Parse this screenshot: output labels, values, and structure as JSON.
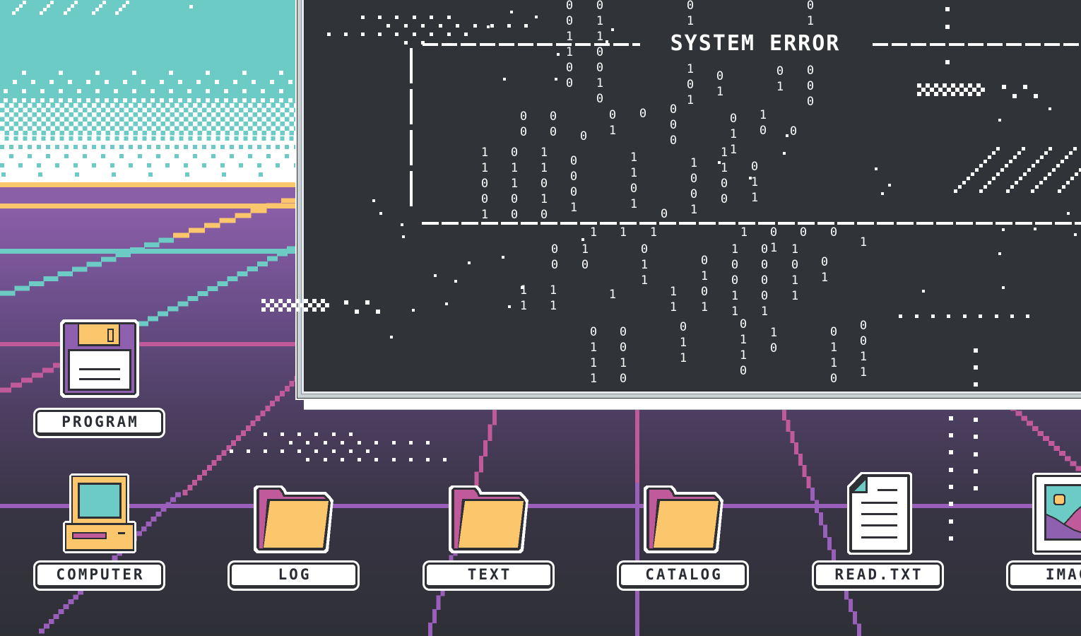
{
  "window": {
    "title": "SYSTEM ERROR"
  },
  "desktop_icons": [
    {
      "label": "PROGRAM",
      "icon": "floppy-disk-icon"
    },
    {
      "label": "COMPUTER",
      "icon": "computer-icon"
    },
    {
      "label": "LOG",
      "icon": "folder-icon"
    },
    {
      "label": "TEXT",
      "icon": "folder-icon"
    },
    {
      "label": "CATALOG",
      "icon": "folder-icon"
    },
    {
      "label": "READ.TXT",
      "icon": "document-icon"
    },
    {
      "label": "IMAGE",
      "icon": "image-icon"
    }
  ],
  "binary_columns": [
    {
      "digits": "001100"
    },
    {
      "digits": "0110010"
    },
    {
      "digits": "01"
    },
    {
      "digits": "101"
    },
    {
      "digits": "01"
    },
    {
      "digits": "000"
    },
    {
      "digits": "01"
    },
    {
      "digits": "01"
    },
    {
      "digits": "00"
    },
    {
      "digits": "00"
    },
    {
      "digits": "0"
    },
    {
      "digits": "01"
    },
    {
      "digits": "0"
    },
    {
      "digits": "000"
    },
    {
      "digits": "011"
    },
    {
      "digits": "10"
    },
    {
      "digits": "0"
    },
    {
      "digits": "11001"
    },
    {
      "digits": "01100"
    },
    {
      "digits": "11010"
    },
    {
      "digits": "0001"
    },
    {
      "digits": "1101"
    },
    {
      "digits": "0"
    },
    {
      "digits": "1001"
    },
    {
      "digits": "1100"
    },
    {
      "digits": "011"
    },
    {
      "digits": "1"
    },
    {
      "digits": "1"
    },
    {
      "digits": "1"
    },
    {
      "digits": "1"
    },
    {
      "digits": "01"
    },
    {
      "digits": "0"
    },
    {
      "digits": "0"
    },
    {
      "digits": "1"
    },
    {
      "digits": "00"
    },
    {
      "digits": "10"
    },
    {
      "digits": "011"
    },
    {
      "digits": "0101"
    },
    {
      "digits": "10011"
    },
    {
      "digits": "00001"
    },
    {
      "digits": "1011"
    },
    {
      "digits": "01"
    },
    {
      "digits": "11"
    },
    {
      "digits": "11"
    },
    {
      "digits": "1"
    },
    {
      "digits": "11"
    },
    {
      "digits": "0111"
    },
    {
      "digits": "0010"
    },
    {
      "digits": "011"
    },
    {
      "digits": "0110"
    },
    {
      "digits": "10"
    },
    {
      "digits": "0110"
    },
    {
      "digits": "0011"
    }
  ],
  "colors": {
    "teal": "#6dcbc5",
    "yellow": "#fcc66c",
    "purple": "#8b5ea8",
    "grid_purple": "#9a5fba",
    "pink": "#c05a9a",
    "dark": "#2e3036",
    "window_bg": "#303338",
    "white": "#ffffff"
  }
}
